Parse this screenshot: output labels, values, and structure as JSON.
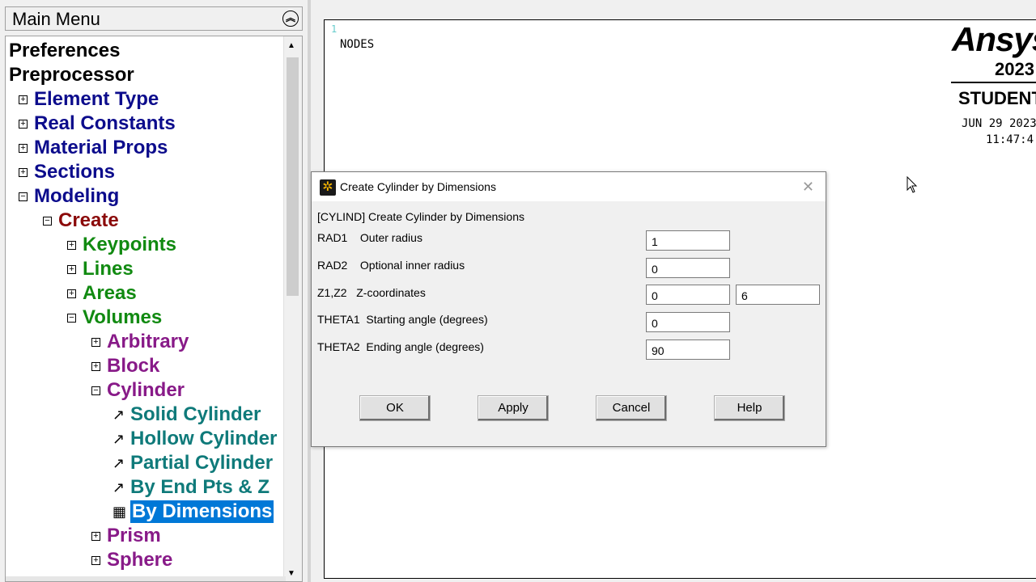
{
  "menu": {
    "title": "Main Menu",
    "items": [
      {
        "label": "Preferences",
        "expander": ""
      },
      {
        "label": "Preprocessor",
        "expander": ""
      },
      {
        "label": "Element Type",
        "expander": "+"
      },
      {
        "label": "Real Constants",
        "expander": "+"
      },
      {
        "label": "Material Props",
        "expander": "+"
      },
      {
        "label": "Sections",
        "expander": "+"
      },
      {
        "label": "Modeling",
        "expander": "−"
      },
      {
        "label": "Create",
        "expander": "−"
      },
      {
        "label": "Keypoints",
        "expander": "+"
      },
      {
        "label": "Lines",
        "expander": "+"
      },
      {
        "label": "Areas",
        "expander": "+"
      },
      {
        "label": "Volumes",
        "expander": "−"
      },
      {
        "label": "Arbitrary",
        "expander": "+"
      },
      {
        "label": "Block",
        "expander": "+"
      },
      {
        "label": "Cylinder",
        "expander": "−"
      },
      {
        "label": "Solid Cylinder",
        "icon": "arrow-pick-icon"
      },
      {
        "label": "Hollow Cylinder",
        "icon": "arrow-pick-icon"
      },
      {
        "label": "Partial Cylinder",
        "icon": "arrow-pick-icon"
      },
      {
        "label": "By End Pts & Z",
        "icon": "arrow-pick-icon"
      },
      {
        "label": "By Dimensions",
        "icon": "dialog-form-icon",
        "selected": true
      },
      {
        "label": "Prism",
        "expander": "+"
      },
      {
        "label": "Sphere",
        "expander": "+"
      }
    ]
  },
  "graphics": {
    "window_number": "1",
    "label": "NODES",
    "logo_text": "Ansys",
    "version": "2023",
    "edition": "STUDENT",
    "date": "JUN 29 2023",
    "time": "11:47:4"
  },
  "dialog": {
    "title": "Create Cylinder by Dimensions",
    "command": "[CYLIND]  Create Cylinder by Dimensions",
    "fields": [
      {
        "label": "RAD1    Outer radius",
        "value": "1"
      },
      {
        "label": "RAD2    Optional inner radius",
        "value": "0"
      },
      {
        "label": "Z1,Z2   Z-coordinates",
        "value": "0",
        "value2": "6"
      },
      {
        "label": "THETA1  Starting angle (degrees)",
        "value": "0"
      },
      {
        "label": "THETA2  Ending angle (degrees)",
        "value": "90"
      }
    ],
    "buttons": {
      "ok": "OK",
      "apply": "Apply",
      "cancel": "Cancel",
      "help": "Help"
    }
  },
  "colors": {
    "selection": "#0078d7",
    "navy": "#0c0c8c",
    "maroon": "#8b0a0a",
    "green": "#118a11",
    "purple": "#881a88",
    "teal": "#0f7a7a"
  }
}
